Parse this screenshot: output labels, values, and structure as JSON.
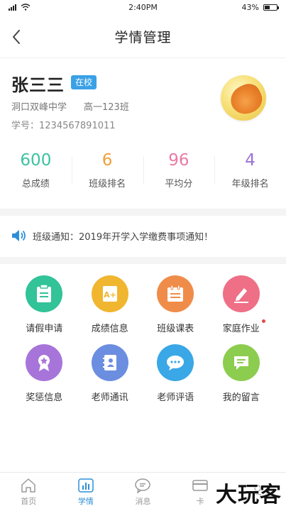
{
  "status_bar": {
    "time": "2:40PM",
    "battery": "43%",
    "battery_level": 0.43
  },
  "header": {
    "title": "学情管理"
  },
  "profile": {
    "name": "张三三",
    "status": "在校",
    "school": "洞口双峰中学",
    "class": "高一123班",
    "student_no": "学号：1234567891011"
  },
  "stats": [
    {
      "value": "600",
      "label": "总成绩",
      "color": "#3cc2a0"
    },
    {
      "value": "6",
      "label": "班级排名",
      "color": "#f2a03a"
    },
    {
      "value": "96",
      "label": "平均分",
      "color": "#ea7aa5"
    },
    {
      "value": "4",
      "label": "年级排名",
      "color": "#9b72d6"
    }
  ],
  "notice": {
    "text": "班级通知：2019年开学入学缴费事项通知！",
    "icon": "speaker-icon",
    "color": "#2d8fd8"
  },
  "grid": [
    {
      "label": "请假申请",
      "icon": "leave-request-icon",
      "color": "#33c398"
    },
    {
      "label": "成绩信息",
      "icon": "grade-info-icon",
      "color": "#f0b630"
    },
    {
      "label": "班级课表",
      "icon": "class-schedule-icon",
      "color": "#f08c4a"
    },
    {
      "label": "家庭作业",
      "icon": "homework-icon",
      "color": "#ee6f86"
    },
    {
      "label": "奖惩信息",
      "icon": "award-icon",
      "color": "#a775d9"
    },
    {
      "label": "老师通讯",
      "icon": "contacts-icon",
      "color": "#6c8ee0"
    },
    {
      "label": "老师评语",
      "icon": "comment-icon",
      "color": "#3aa7e6"
    },
    {
      "label": "我的留言",
      "icon": "message-icon",
      "color": "#8ccc4f"
    }
  ],
  "tabbar": [
    {
      "label": "首页",
      "icon": "home-icon"
    },
    {
      "label": "学情",
      "icon": "chart-icon",
      "active": true
    },
    {
      "label": "消息",
      "icon": "chat-icon"
    },
    {
      "label": "卡",
      "icon": "card-icon"
    },
    {
      "label": "",
      "icon": "profile-icon"
    }
  ],
  "watermark": "大玩客"
}
